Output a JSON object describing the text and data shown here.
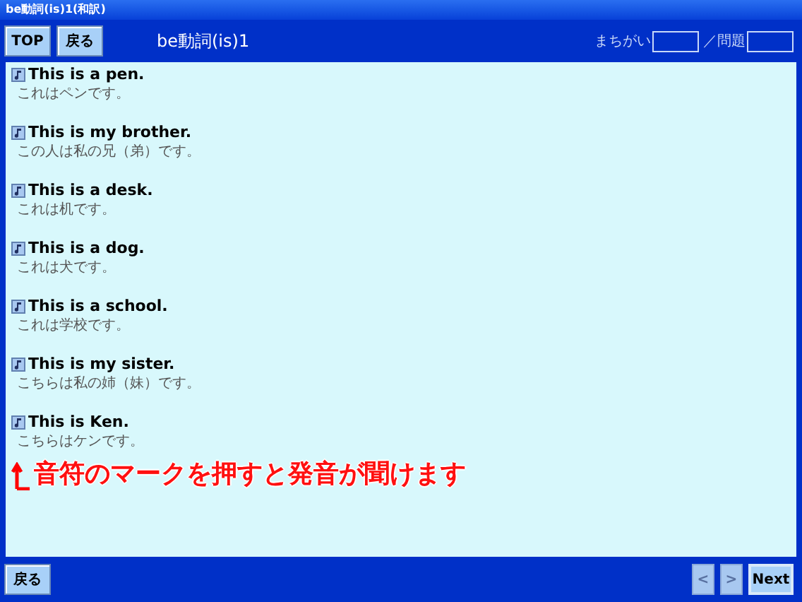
{
  "window": {
    "title": "be動詞(is)1(和訳)"
  },
  "header": {
    "buttons": [
      "TOP",
      "戻る"
    ],
    "title": "be動詞(is)1",
    "mistakes_label": "まちがい",
    "problems_label": "／問題"
  },
  "sentences": [
    {
      "english": "This is a pen.",
      "japanese": "これはペンです。"
    },
    {
      "english": "This is my brother.",
      "japanese": "この人は私の兄（弟）です。"
    },
    {
      "english": "This is a desk.",
      "japanese": "これは机です。"
    },
    {
      "english": "This is a dog.",
      "japanese": "これは犬です。"
    },
    {
      "english": "This is a school.",
      "japanese": "これは学校です。"
    },
    {
      "english": "This is my sister.",
      "japanese": "こちらは私の姉（妹）です。"
    },
    {
      "english": "This is Ken.",
      "japanese": "こちらはケンです。"
    }
  ],
  "hint": "音符のマークを押すと発音が聞けます",
  "footer": {
    "back": "戻る",
    "nav": [
      {
        "label": "<",
        "disabled": true
      },
      {
        "label": ">",
        "disabled": true
      },
      {
        "label": "Next",
        "disabled": false
      }
    ]
  }
}
